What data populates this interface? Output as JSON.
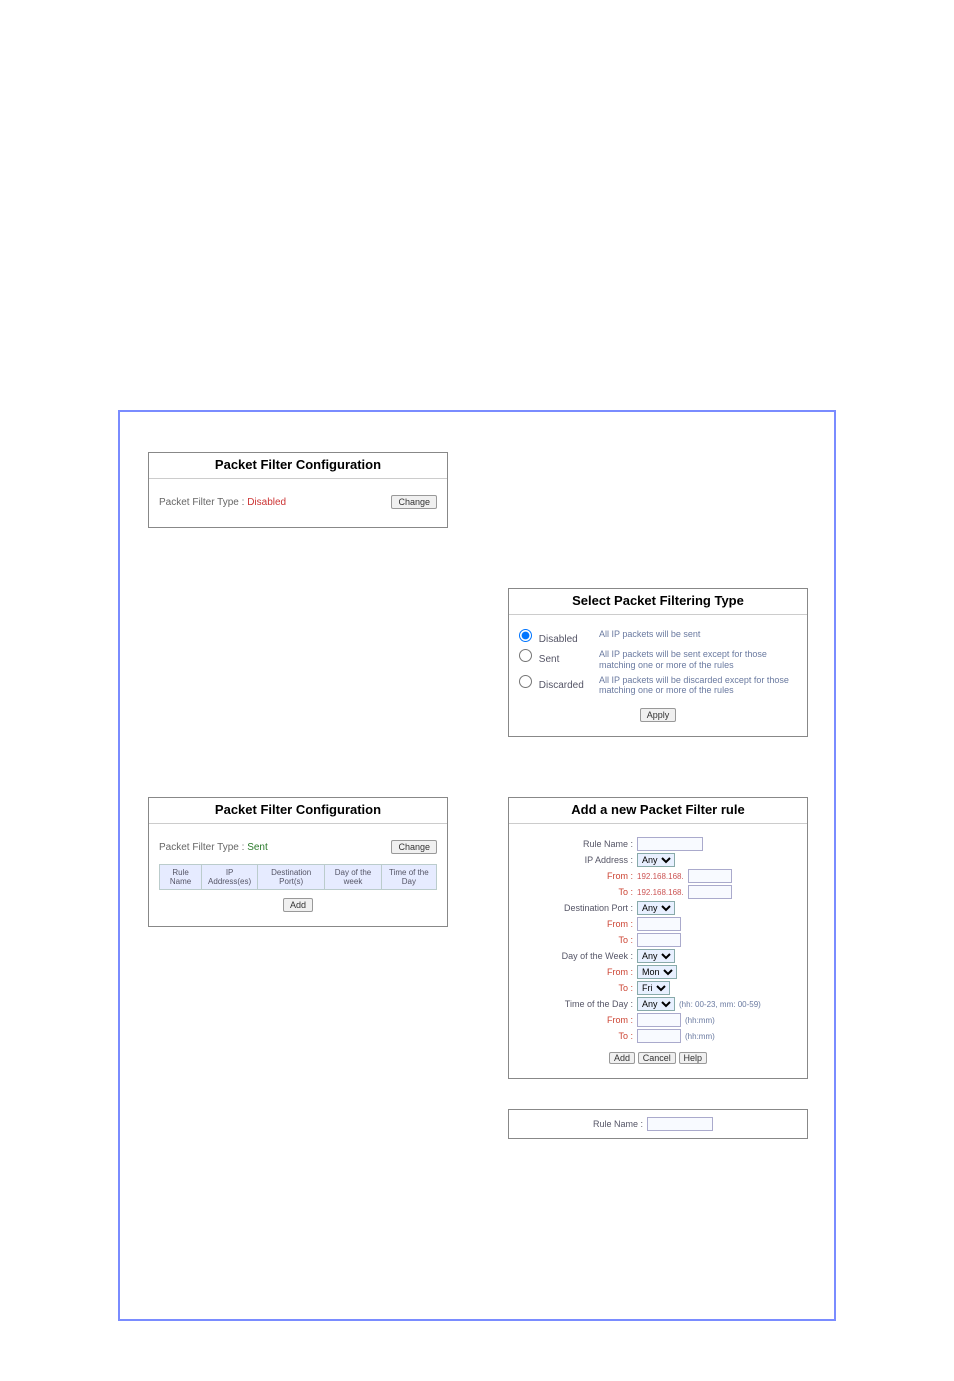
{
  "panel1": {
    "title": "Packet Filter Configuration",
    "type_label": "Packet Filter Type :",
    "type_value": "Disabled",
    "change_btn": "Change"
  },
  "panel2": {
    "title": "Select Packet Filtering Type",
    "options": [
      {
        "label": "Disabled",
        "desc": "All IP packets will be sent"
      },
      {
        "label": "Sent",
        "desc": "All IP packets will be sent except for those matching one or more of the rules"
      },
      {
        "label": "Discarded",
        "desc": "All IP packets will be discarded except for those matching one or more of the rules"
      }
    ],
    "apply_btn": "Apply"
  },
  "panel3": {
    "title": "Packet Filter Configuration",
    "type_label": "Packet Filter Type :",
    "type_value": "Sent",
    "change_btn": "Change",
    "cols": [
      "Rule Name",
      "IP Address(es)",
      "Destination Port(s)",
      "Day of the week",
      "Time of the Day"
    ],
    "add_btn": "Add"
  },
  "panel4": {
    "title": "Add a new Packet Filter rule",
    "rule_name_label": "Rule Name :",
    "ip_label": "IP Address :",
    "ip_sel": "Any",
    "ip_from_label": "From :",
    "ip_from_prefix": "192.168.168.",
    "ip_to_label": "To :",
    "ip_to_prefix": "192.168.168.",
    "port_label": "Destination Port :",
    "port_sel": "Any",
    "port_from_label": "From :",
    "port_to_label": "To :",
    "dow_label": "Day of the Week :",
    "dow_sel": "Any",
    "dow_from_label": "From :",
    "dow_from_sel": "Mon",
    "dow_to_label": "To :",
    "dow_to_sel": "Fri",
    "tod_label": "Time of the Day :",
    "tod_sel": "Any",
    "tod_hint": "(hh: 00-23, mm: 00-59)",
    "tod_from_label": "From :",
    "tod_from_hint": "(hh:mm)",
    "tod_to_label": "To :",
    "tod_to_hint": "(hh:mm)",
    "add_btn": "Add",
    "cancel_btn": "Cancel",
    "help_btn": "Help"
  },
  "panel5": {
    "rule_name_label": "Rule Name :"
  }
}
